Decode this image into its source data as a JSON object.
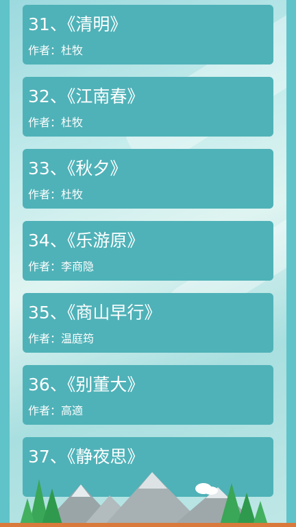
{
  "poems": [
    {
      "number": "31",
      "title": "《清明》",
      "author_label": "作者",
      "author": "杜牧"
    },
    {
      "number": "32",
      "title": "《江南春》",
      "author_label": "作者",
      "author": "杜牧"
    },
    {
      "number": "33",
      "title": "《秋夕》",
      "author_label": "作者",
      "author": "杜牧"
    },
    {
      "number": "34",
      "title": "《乐游原》",
      "author_label": "作者",
      "author": "李商隐"
    },
    {
      "number": "35",
      "title": "《商山早行》",
      "author_label": "作者",
      "author": "温庭筠"
    },
    {
      "number": "36",
      "title": "《别董大》",
      "author_label": "作者",
      "author": "高適"
    },
    {
      "number": "37",
      "title": "《静夜思》",
      "author_label": "作者",
      "author": ""
    }
  ],
  "colors": {
    "card": "#4fb2b8",
    "card_text": "#ffffff",
    "side_bar": "#5fc3c9"
  }
}
